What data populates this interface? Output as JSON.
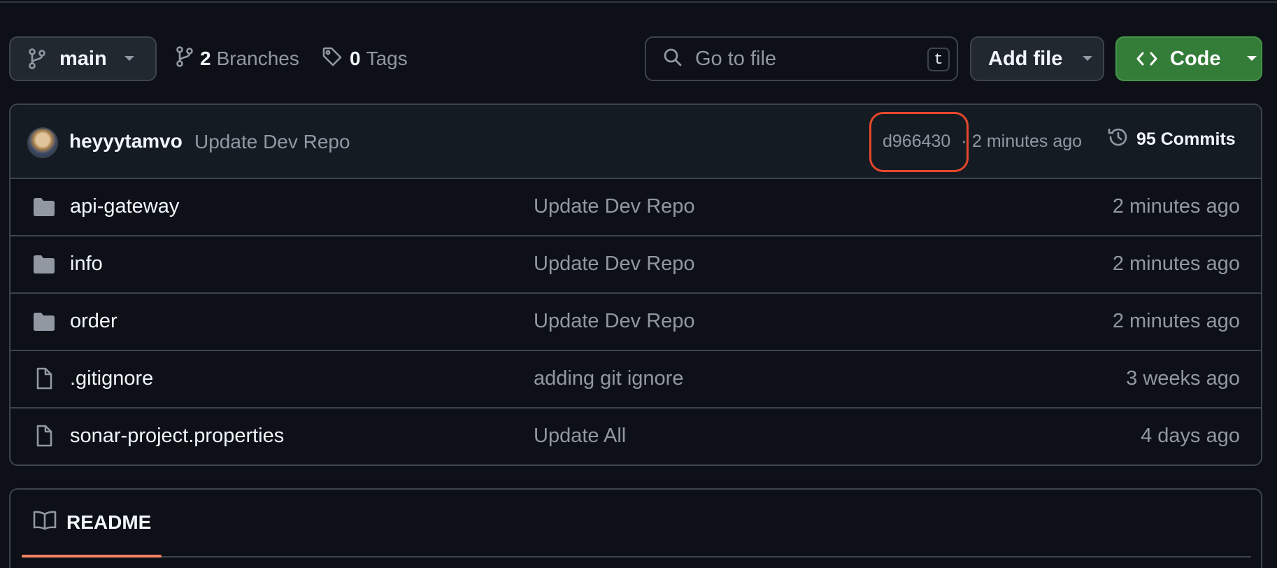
{
  "toolbar": {
    "branch": "main",
    "branches_count": "2",
    "branches_label": "Branches",
    "tags_count": "0",
    "tags_label": "Tags",
    "search_placeholder": "Go to file",
    "search_shortcut": "t",
    "add_file_label": "Add file",
    "code_label": "Code"
  },
  "latest_commit": {
    "author": "heyyytamvo",
    "message": "Update Dev Repo",
    "sha": "d966430",
    "separator": "·",
    "time": "2 minutes ago",
    "commits_count_label": "95 Commits"
  },
  "files": [
    {
      "type": "folder",
      "name": "api-gateway",
      "message": "Update Dev Repo",
      "time": "2 minutes ago"
    },
    {
      "type": "folder",
      "name": "info",
      "message": "Update Dev Repo",
      "time": "2 minutes ago"
    },
    {
      "type": "folder",
      "name": "order",
      "message": "Update Dev Repo",
      "time": "2 minutes ago"
    },
    {
      "type": "file",
      "name": ".gitignore",
      "message": "adding git ignore",
      "time": "3 weeks ago"
    },
    {
      "type": "file",
      "name": "sonar-project.properties",
      "message": "Update All",
      "time": "4 days ago"
    }
  ],
  "readme": {
    "tab_label": "README"
  },
  "colors": {
    "background": "#0d1117",
    "code_button": "#347d39",
    "highlight_outline": "#e5482c",
    "tab_underline": "#f78166"
  }
}
